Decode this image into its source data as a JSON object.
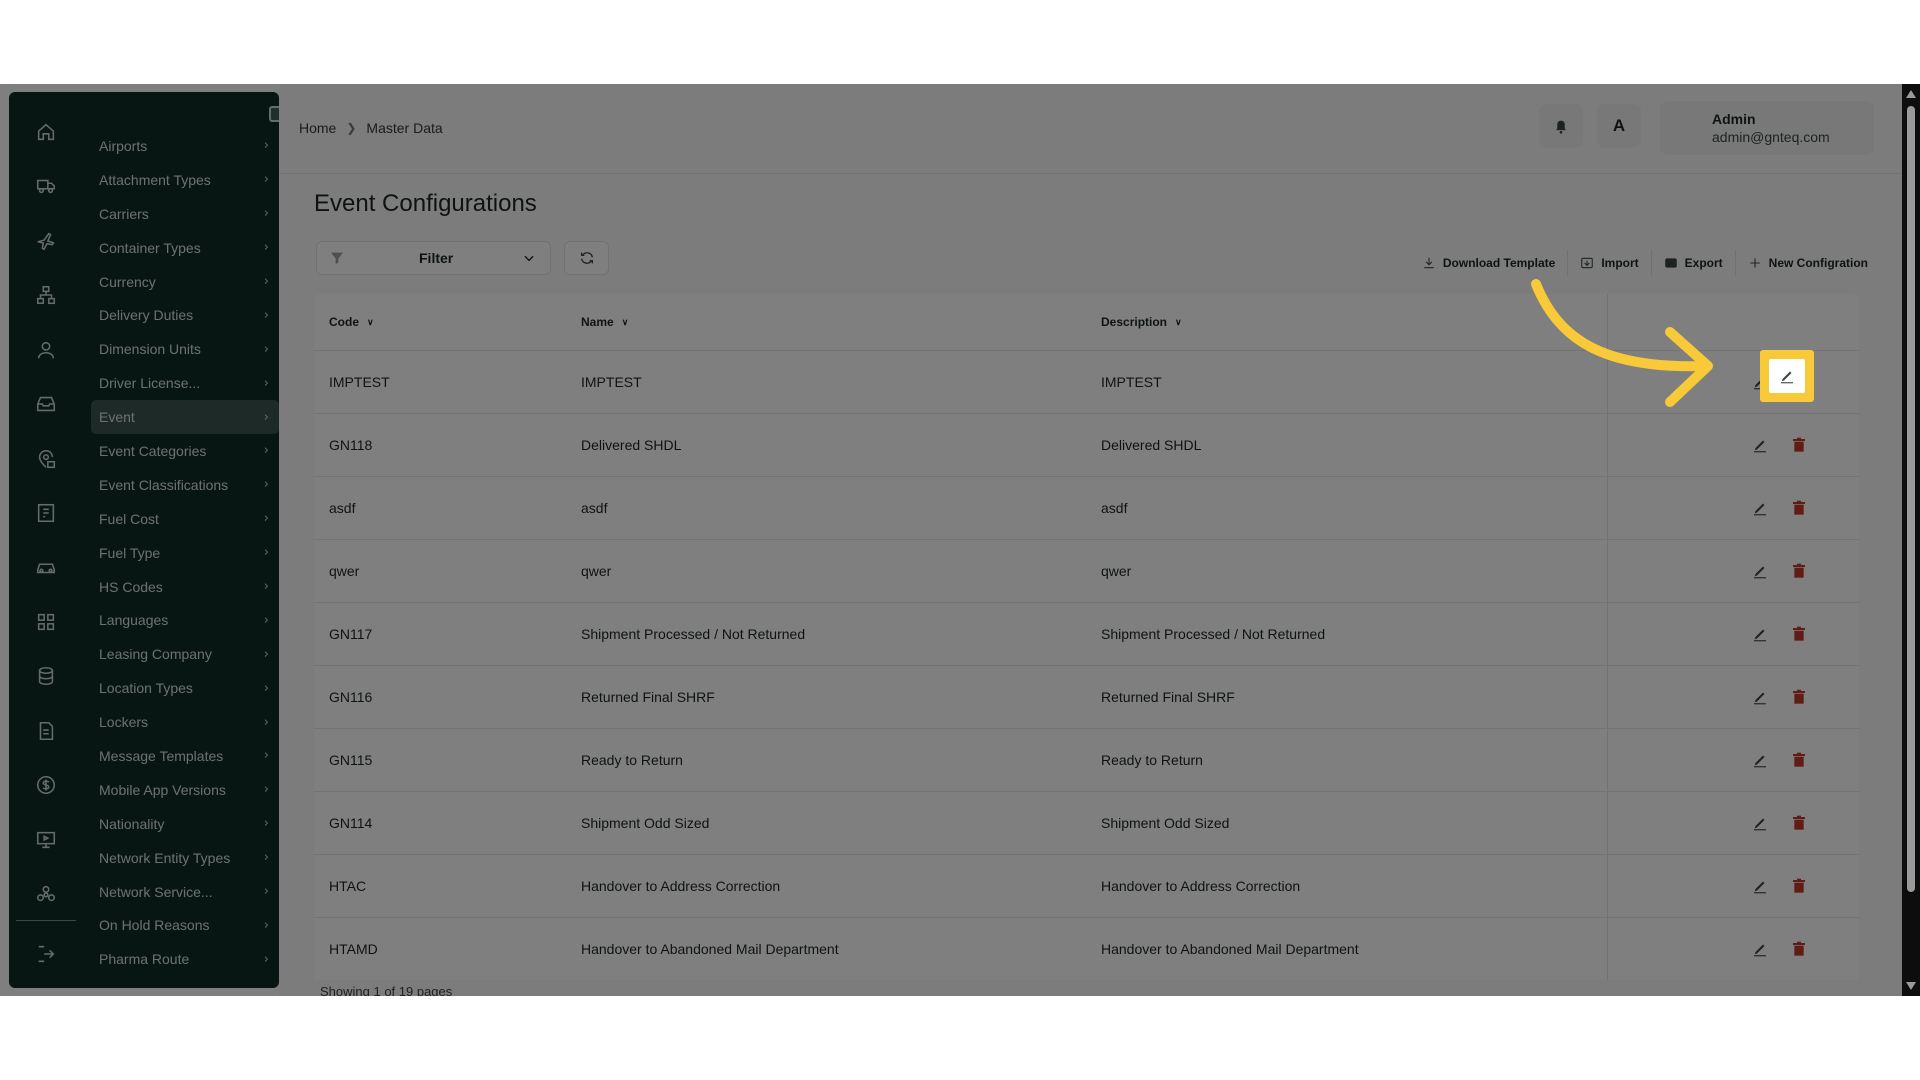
{
  "breadcrumb": {
    "home": "Home",
    "current": "Master Data"
  },
  "user": {
    "name": "Admin",
    "email": "admin@gnteq.com"
  },
  "page_title": "Event Configurations",
  "filter": {
    "label": "Filter"
  },
  "actions": {
    "download_template": "Download Template",
    "import": "Import",
    "export": "Export",
    "new_configuration": "New Configration"
  },
  "table": {
    "headers": {
      "code": "Code",
      "name": "Name",
      "description": "Description"
    },
    "rows": [
      {
        "code": "IMPTEST",
        "name": "IMPTEST",
        "description": "IMPTEST"
      },
      {
        "code": "GN118",
        "name": "Delivered SHDL",
        "description": "Delivered SHDL"
      },
      {
        "code": "asdf",
        "name": "asdf",
        "description": "asdf"
      },
      {
        "code": "qwer",
        "name": "qwer",
        "description": "qwer"
      },
      {
        "code": "GN117",
        "name": "Shipment Processed / Not Returned",
        "description": "Shipment Processed / Not Returned"
      },
      {
        "code": "GN116",
        "name": "Returned Final SHRF",
        "description": "Returned Final SHRF"
      },
      {
        "code": "GN115",
        "name": "Ready to Return",
        "description": "Ready to Return"
      },
      {
        "code": "GN114",
        "name": "Shipment Odd Sized",
        "description": "Shipment Odd Sized"
      },
      {
        "code": "HTAC",
        "name": "Handover to Address Correction",
        "description": "Handover to Address Correction"
      },
      {
        "code": "HTAMD",
        "name": "Handover to Abandoned Mail Department",
        "description": "Handover to Abandoned Mail Department"
      }
    ]
  },
  "footer": {
    "pagination_text": "Showing 1 of 19 pages"
  },
  "sidebar": {
    "active_item": "Event",
    "items": [
      "Airports",
      "Attachment Types",
      "Carriers",
      "Container Types",
      "Currency",
      "Delivery Duties",
      "Dimension Units",
      "Driver License...",
      "Event",
      "Event Categories",
      "Event Classifications",
      "Fuel Cost",
      "Fuel Type",
      "HS Codes",
      "Languages",
      "Leasing Company",
      "Location Types",
      "Lockers",
      "Message Templates",
      "Mobile App Versions",
      "Nationality",
      "Network Entity Types",
      "Network Service...",
      "On Hold Reasons",
      "Pharma Route"
    ],
    "rail_icons": [
      "home-icon",
      "truck-icon",
      "plane-icon",
      "network-icon",
      "user-icon",
      "inbox-icon",
      "location-lock-icon",
      "building-icon",
      "car-icon",
      "grid-icon",
      "database-icon",
      "document-icon",
      "dollar-icon",
      "monitor-icon",
      "hub-icon",
      "logout-icon"
    ]
  },
  "colors": {
    "sidebar_bg": "#0f2c27",
    "active_item_bg": "#3d5551",
    "highlight": "#f8c938",
    "delete": "#c0392b"
  },
  "language_badge": "A"
}
